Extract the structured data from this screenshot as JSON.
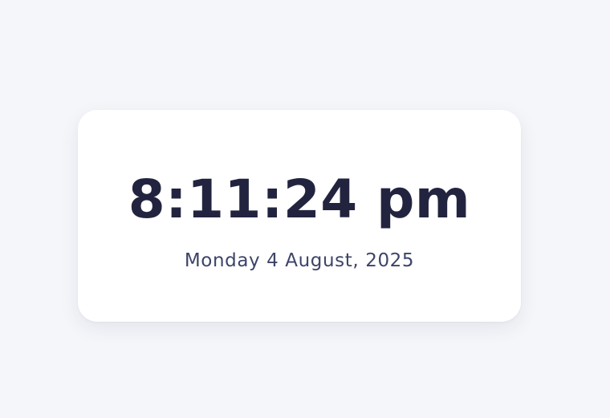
{
  "clock": {
    "time": "8:11:24 pm",
    "date": "Monday 4 August, 2025"
  },
  "colors": {
    "background": "#f5f6fa",
    "card": "#ffffff",
    "time_text": "#22243f",
    "date_text": "#3d4468"
  }
}
